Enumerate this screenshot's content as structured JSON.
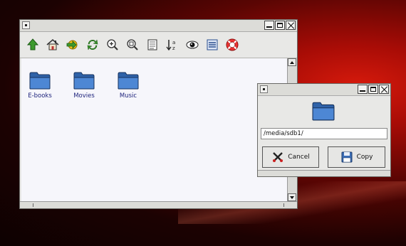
{
  "main_window": {
    "title": "",
    "toolbar": [
      {
        "name": "up-icon"
      },
      {
        "name": "home-icon"
      },
      {
        "name": "go-icon"
      },
      {
        "name": "refresh-icon"
      },
      {
        "name": "zoom-in-icon"
      },
      {
        "name": "zoom-fit-icon"
      },
      {
        "name": "view-icon"
      },
      {
        "name": "sort-icon"
      },
      {
        "name": "eye-icon"
      },
      {
        "name": "details-icon"
      },
      {
        "name": "help-icon"
      }
    ],
    "folders": [
      {
        "label": "E-books"
      },
      {
        "label": "Movies"
      },
      {
        "label": "Music"
      }
    ]
  },
  "dialog": {
    "title": "",
    "path_value": "/media/sdb1/",
    "cancel_label": "Cancel",
    "copy_label": "Copy"
  },
  "colors": {
    "folder_blue": "#3b74c4",
    "label_text": "#1a1f7a"
  }
}
